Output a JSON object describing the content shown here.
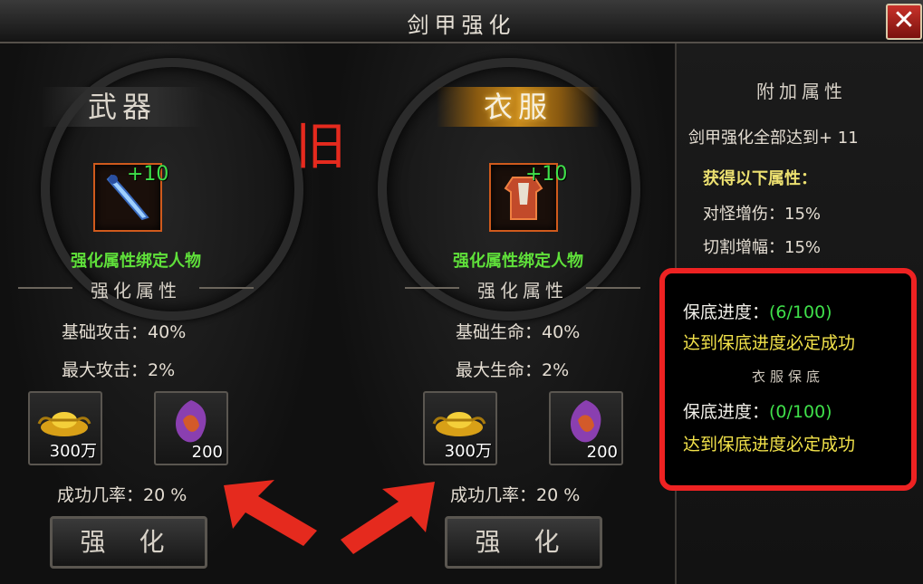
{
  "window": {
    "title": "剑甲强化",
    "close_icon": "✕"
  },
  "annotation": {
    "old_label": "旧"
  },
  "weapon": {
    "name": "武器",
    "enhance_level": "+10",
    "bind_text": "强化属性绑定人物",
    "section_title": "强化属性",
    "stats": [
      {
        "label": "基础攻击：",
        "value": "40%"
      },
      {
        "label": "最大攻击：",
        "value": "2%"
      }
    ],
    "costs": [
      {
        "icon": "gold-ingot-icon",
        "amount": "300万"
      },
      {
        "icon": "enhance-stone-icon",
        "amount": "200"
      }
    ],
    "success_rate": "成功几率：20 %",
    "enhance_button": "强 化"
  },
  "armor": {
    "name": "衣服",
    "enhance_level": "+10",
    "bind_text": "强化属性绑定人物",
    "section_title": "强化属性",
    "stats": [
      {
        "label": "基础生命：",
        "value": "40%"
      },
      {
        "label": "最大生命：",
        "value": "2%"
      }
    ],
    "costs": [
      {
        "icon": "gold-ingot-icon",
        "amount": "300万"
      },
      {
        "icon": "enhance-stone-icon",
        "amount": "200"
      }
    ],
    "success_rate": "成功几率：20 %",
    "enhance_button": "强 化"
  },
  "bonus": {
    "title": "附加属性",
    "requirement": "剑甲强化全部达到+ 11",
    "gain_title": "获得以下属性：",
    "attributes": [
      {
        "label": "对怪增伤：",
        "value": "15%"
      },
      {
        "label": "切割增幅：",
        "value": "15%"
      }
    ]
  },
  "guarantee": {
    "weapon_progress_label": "保底进度：",
    "weapon_progress_value": "(6/100)",
    "weapon_note": "达到保底进度必定成功",
    "armor_title": "衣服保底",
    "armor_progress_label": "保底进度：",
    "armor_progress_value": "(0/100)",
    "armor_note": "达到保底进度必定成功"
  },
  "colors": {
    "green": "#3fe04a",
    "gold_text": "#f2e24a",
    "highlight_red": "#ee2222",
    "item_frame": "#d05a1c"
  }
}
